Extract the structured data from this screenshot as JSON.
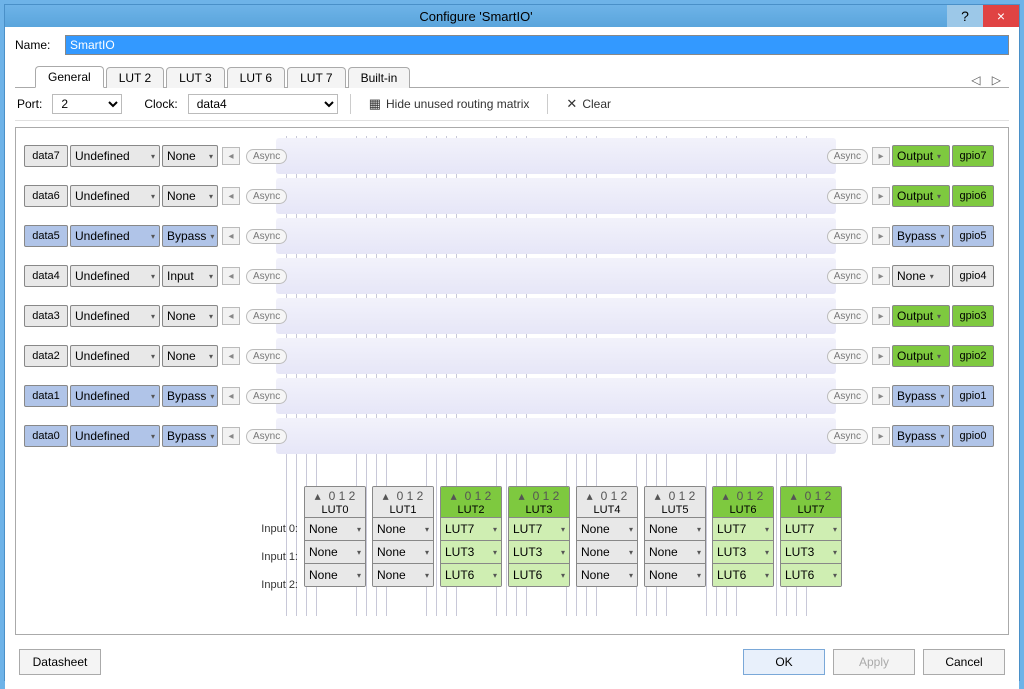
{
  "window": {
    "title": "Configure 'SmartIO'",
    "help": "?",
    "close": "×"
  },
  "name": {
    "label": "Name:",
    "value": "SmartIO"
  },
  "tabs": [
    "General",
    "LUT 2",
    "LUT 3",
    "LUT 6",
    "LUT 7",
    "Built-in"
  ],
  "active_tab": 0,
  "tabs_nav": {
    "prev": "◁",
    "next": "▷"
  },
  "toolbar": {
    "port_label": "Port:",
    "port_value": "2",
    "clock_label": "Clock:",
    "clock_value": "data4",
    "hide_label": "Hide unused routing matrix",
    "clear_label": "Clear"
  },
  "async_label": "Async",
  "data_rows": [
    {
      "name": "data7",
      "mode": "Undefined",
      "conn": "None",
      "blue": false
    },
    {
      "name": "data6",
      "mode": "Undefined",
      "conn": "None",
      "blue": false
    },
    {
      "name": "data5",
      "mode": "Undefined",
      "conn": "Bypass",
      "blue": true
    },
    {
      "name": "data4",
      "mode": "Undefined",
      "conn": "Input",
      "blue": false
    },
    {
      "name": "data3",
      "mode": "Undefined",
      "conn": "None",
      "blue": false
    },
    {
      "name": "data2",
      "mode": "Undefined",
      "conn": "None",
      "blue": false
    },
    {
      "name": "data1",
      "mode": "Undefined",
      "conn": "Bypass",
      "blue": true
    },
    {
      "name": "data0",
      "mode": "Undefined",
      "conn": "Bypass",
      "blue": true
    }
  ],
  "gpio_rows": [
    {
      "name": "gpio7",
      "mode": "Output",
      "cls": "green"
    },
    {
      "name": "gpio6",
      "mode": "Output",
      "cls": "green"
    },
    {
      "name": "gpio5",
      "mode": "Bypass",
      "cls": "blue"
    },
    {
      "name": "gpio4",
      "mode": "None",
      "cls": "gray"
    },
    {
      "name": "gpio3",
      "mode": "Output",
      "cls": "green"
    },
    {
      "name": "gpio2",
      "mode": "Output",
      "cls": "green"
    },
    {
      "name": "gpio1",
      "mode": "Bypass",
      "cls": "blue"
    },
    {
      "name": "gpio0",
      "mode": "Bypass",
      "cls": "blue"
    }
  ],
  "input_labels": [
    "Input 0:",
    "Input 1:",
    "Input 2:"
  ],
  "lut_idx_header": "0 1 2",
  "luts": [
    {
      "name": "LUT0",
      "green": false,
      "inputs": [
        "None",
        "None",
        "None"
      ]
    },
    {
      "name": "LUT1",
      "green": false,
      "inputs": [
        "None",
        "None",
        "None"
      ]
    },
    {
      "name": "LUT2",
      "green": true,
      "inputs": [
        "LUT7",
        "LUT3",
        "LUT6"
      ]
    },
    {
      "name": "LUT3",
      "green": true,
      "inputs": [
        "LUT7",
        "LUT3",
        "LUT6"
      ]
    },
    {
      "name": "LUT4",
      "green": false,
      "inputs": [
        "None",
        "None",
        "None"
      ]
    },
    {
      "name": "LUT5",
      "green": false,
      "inputs": [
        "None",
        "None",
        "None"
      ]
    },
    {
      "name": "LUT6",
      "green": true,
      "inputs": [
        "LUT7",
        "LUT3",
        "LUT6"
      ]
    },
    {
      "name": "LUT7",
      "green": true,
      "inputs": [
        "LUT7",
        "LUT3",
        "LUT6"
      ]
    }
  ],
  "footer": {
    "datasheet": "Datasheet",
    "ok": "OK",
    "apply": "Apply",
    "cancel": "Cancel"
  }
}
